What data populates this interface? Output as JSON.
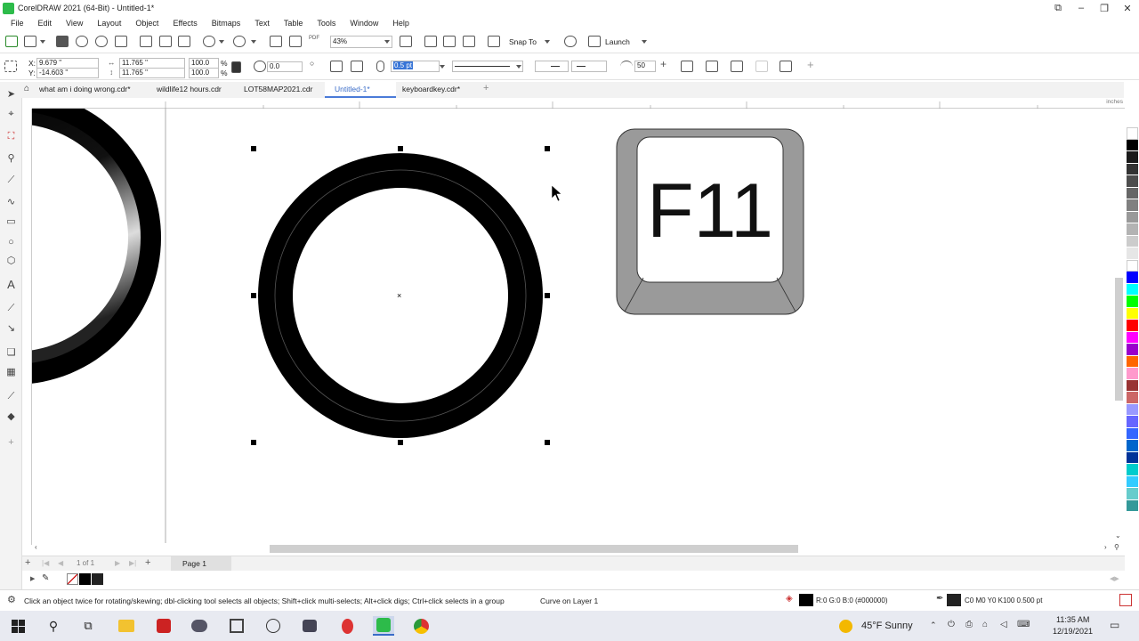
{
  "window": {
    "title": "CorelDRAW 2021 (64-Bit) - Untitled-1*",
    "minimize_glyph": "–",
    "restore_glyph": "❐",
    "close_glyph": "✕",
    "help_glyph": "⧉"
  },
  "menu": [
    "File",
    "Edit",
    "View",
    "Layout",
    "Object",
    "Effects",
    "Bitmaps",
    "Text",
    "Table",
    "Tools",
    "Window",
    "Help"
  ],
  "standard_toolbar": {
    "zoom_value": "43%",
    "snap_to_label": "Snap To",
    "launch_label": "Launch",
    "pdf_label": "PDF"
  },
  "property_bar": {
    "x_label": "X:",
    "x_value": "9.679 \"",
    "y_label": "Y:",
    "y_value": "-14.603 \"",
    "width_value": "11.765 \"",
    "height_value": "11.765 \"",
    "scale_x": "100.0",
    "scale_y": "100.0",
    "pct1": "%",
    "pct2": "%",
    "rotation_value": "0.0",
    "outline_width": "0.5 pt",
    "smoothness_value": "50"
  },
  "doc_tabs": [
    {
      "label": "what am i doing wrong.cdr*",
      "active": false
    },
    {
      "label": "wildlife12 hours.cdr",
      "active": false
    },
    {
      "label": "LOT58MAP2021.cdr",
      "active": false
    },
    {
      "label": "Untitled-1*",
      "active": true
    },
    {
      "label": "keyboardkey.cdr*",
      "active": false
    }
  ],
  "ruler": {
    "unit": "inches"
  },
  "canvas": {
    "key_label": "F11"
  },
  "page_nav": {
    "page_count": "1 of 1",
    "page_tab": "Page 1"
  },
  "status": {
    "hint": "Click an object twice for rotating/skewing; dbl-clicking tool selects all objects; Shift+click multi-selects; Alt+click digs; Ctrl+click selects in a group",
    "object_info": "Curve on Layer 1",
    "fill_info": "R:0 G:0 B:0 (#000000)",
    "outline_info": "C0 M0 Y0 K100  0.500 pt"
  },
  "taskbar": {
    "weather": "45°F  Sunny",
    "time": "11:35 AM",
    "date": "12/19/2021"
  },
  "palette_colors": [
    "#ffffff",
    "#000000",
    "#1a1a1a",
    "#333333",
    "#4d4d4d",
    "#666666",
    "#808080",
    "#999999",
    "#b3b3b3",
    "#cccccc",
    "#e6e6e6",
    "#ffffff",
    "#0000ff",
    "#00ffff",
    "#00ff00",
    "#ffff00",
    "#ff0000",
    "#ff00ff",
    "#9900cc",
    "#ff6600",
    "#ff99cc",
    "#993333",
    "#cc6666",
    "#9999ff",
    "#6666ff",
    "#3366ff",
    "#0066cc",
    "#003399",
    "#00cccc",
    "#33ccff",
    "#66cccc",
    "#339999"
  ]
}
